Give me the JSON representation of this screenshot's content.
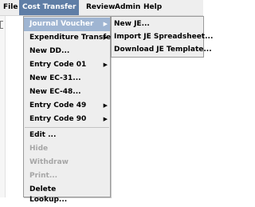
{
  "menubar": {
    "file": "File",
    "cost_transfer": "Cost Transfer",
    "review": "Review",
    "admin": "Admin",
    "help": "Help"
  },
  "cost_transfer_menu": {
    "items": [
      {
        "label": "Journal Voucher",
        "submenu": true,
        "selected": true
      },
      {
        "label": "Expenditure Transfer",
        "submenu": true
      },
      {
        "label": "New DD..."
      },
      {
        "label": "Entry Code 01",
        "submenu": true
      },
      {
        "label": "New EC-31..."
      },
      {
        "label": "New EC-48..."
      },
      {
        "label": "Entry Code 49",
        "submenu": true
      },
      {
        "label": "Entry Code 90",
        "submenu": true
      },
      {
        "label": "Edit ..."
      },
      {
        "label": "Hide",
        "disabled": true
      },
      {
        "label": "Withdraw",
        "disabled": true
      },
      {
        "label": "Print...",
        "disabled": true
      },
      {
        "label": "Delete"
      },
      {
        "label": "Lookup..."
      }
    ]
  },
  "journal_voucher_submenu": {
    "items": [
      {
        "label": "New JE..."
      },
      {
        "label": "Import JE Spreadsheet..."
      },
      {
        "label": "Download JE Template..."
      }
    ]
  },
  "icons": {
    "submenu_arrow": "chevron-right-icon"
  },
  "colors": {
    "menubar_active": "#5f7ea6",
    "selected_row": "#9fb5d2",
    "disabled_text": "#a6a6a6"
  }
}
